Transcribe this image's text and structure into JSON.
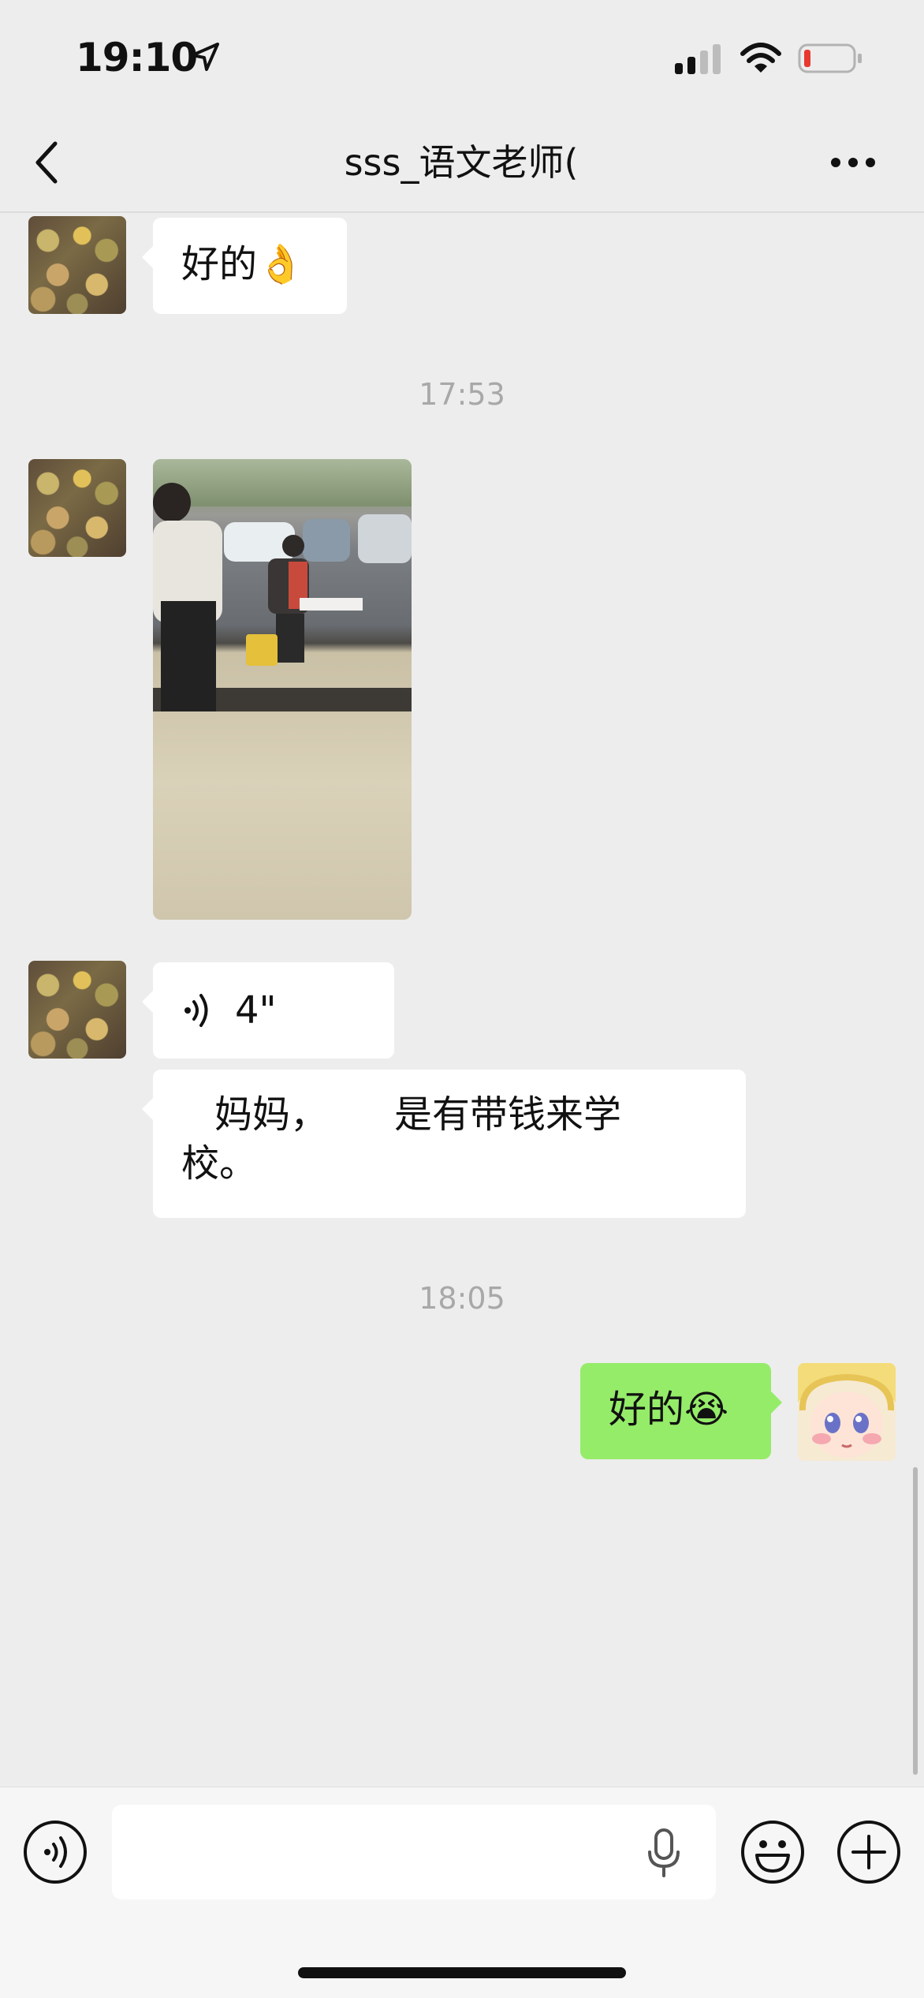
{
  "status_bar": {
    "time": "19:10",
    "icons": [
      "location-arrow-icon",
      "cellular-signal-icon",
      "wifi-icon",
      "battery-low-icon"
    ]
  },
  "nav": {
    "title": "sss_语文老师(",
    "back_icon": "chevron-left-icon",
    "more_icon": "ellipsis-icon"
  },
  "messages": [
    {
      "type": "text",
      "side": "left",
      "text": "好的",
      "emoji": "👌"
    },
    {
      "type": "timestamp",
      "text": "17:53"
    },
    {
      "type": "image",
      "side": "left"
    },
    {
      "type": "voice",
      "side": "left",
      "duration": "4\""
    },
    {
      "type": "text",
      "side": "left",
      "line1": "妈妈，",
      "line1b": "是有带钱来学",
      "line2": "校。"
    },
    {
      "type": "timestamp",
      "text": "18:05"
    },
    {
      "type": "text",
      "side": "right",
      "text": "好的",
      "emoji": "😭"
    }
  ],
  "input_bar": {
    "placeholder": "",
    "icons": [
      "voice-mode-icon",
      "microphone-icon",
      "emoji-icon",
      "plus-icon"
    ]
  },
  "colors": {
    "background": "#ededed",
    "sent_bubble": "#95ec69",
    "received_bubble": "#ffffff",
    "timestamp_text": "#a8a8a8",
    "battery_low": "#e8392f"
  }
}
